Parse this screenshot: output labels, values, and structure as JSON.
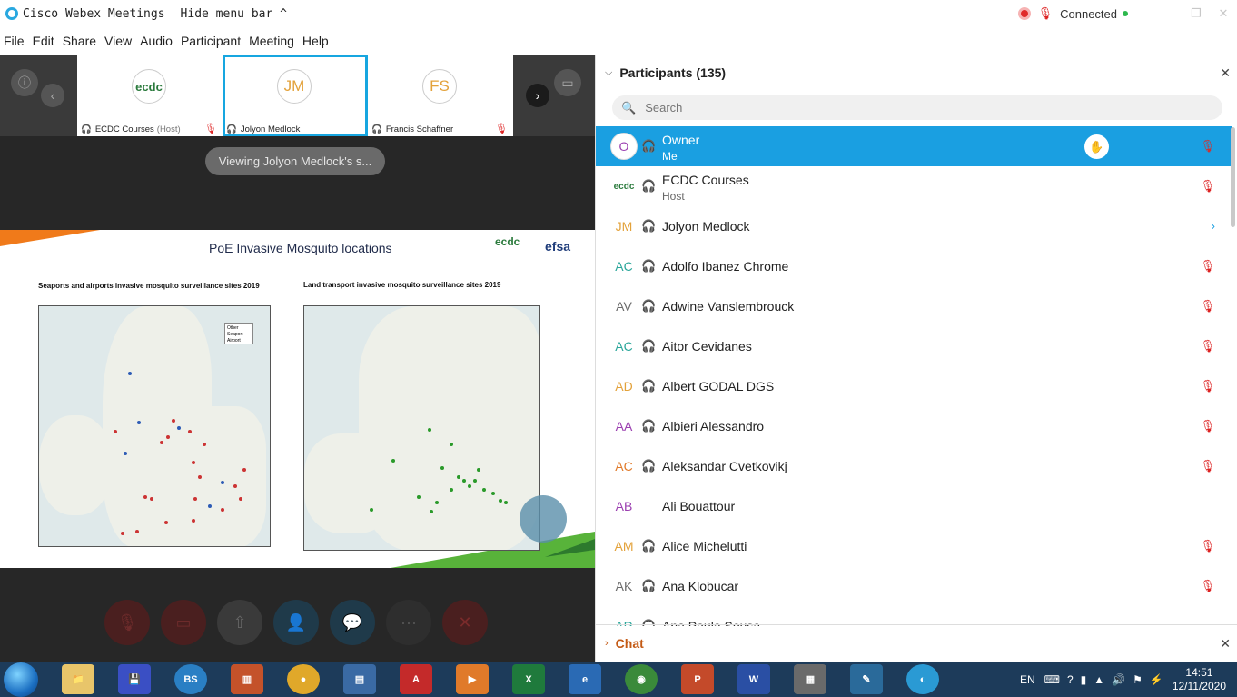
{
  "titlebar": {
    "app_title": "Cisco Webex Meetings",
    "hide_menu": "Hide menu bar ^",
    "connection": "Connected",
    "minimize": "—",
    "maximize": "❐",
    "close": "✕"
  },
  "menu": [
    "File",
    "Edit",
    "Share",
    "View",
    "Audio",
    "Participant",
    "Meeting",
    "Help"
  ],
  "thumbnails": [
    {
      "name": "ECDC Courses",
      "role": "(Host)",
      "initials": "ecdc"
    },
    {
      "name": "Jolyon Medlock",
      "role": "",
      "initials": "JM"
    },
    {
      "name": "Francis Schaffner",
      "role": "",
      "initials": "FS"
    }
  ],
  "viewing_label": "Viewing Jolyon Medlock's s...",
  "slide": {
    "title": "PoE Invasive Mosquito locations",
    "map_left_title": "Seaports and airports invasive mosquito surveillance sites 2019",
    "map_right_title": "Land transport invasive mosquito surveillance sites 2019",
    "legend": [
      "Other",
      "Seaport",
      "Airport"
    ],
    "logo_ecdc": "ecdc",
    "logo_efsa": "efsa"
  },
  "participants": {
    "header": "Participants (135)",
    "search_placeholder": "Search",
    "rows": [
      {
        "initials": "O",
        "name": "Owner",
        "sub": "Me",
        "color": "#9b3fb0"
      },
      {
        "initials": "ecdc",
        "name": "ECDC Courses",
        "sub": "Host",
        "color": "#2a7a3c"
      },
      {
        "initials": "JM",
        "name": "Jolyon Medlock",
        "sub": "",
        "color": "#e3a23b"
      },
      {
        "initials": "AC",
        "name": "Adolfo Ibanez Chrome",
        "sub": "",
        "color": "#2aa69a"
      },
      {
        "initials": "AV",
        "name": "Adwine Vanslembrouck",
        "sub": "",
        "color": "#6b6b6b"
      },
      {
        "initials": "AC",
        "name": "Aitor Cevidanes",
        "sub": "",
        "color": "#2aa69a"
      },
      {
        "initials": "AD",
        "name": "Albert GODAL DGS",
        "sub": "",
        "color": "#e3a23b"
      },
      {
        "initials": "AA",
        "name": "Albieri Alessandro",
        "sub": "",
        "color": "#9b3fb0"
      },
      {
        "initials": "AC",
        "name": "Aleksandar Cvetkovikj",
        "sub": "",
        "color": "#e07a2a"
      },
      {
        "initials": "AB",
        "name": "Ali Bouattour",
        "sub": "",
        "color": "#9b3fb0"
      },
      {
        "initials": "AM",
        "name": "Alice Michelutti",
        "sub": "",
        "color": "#e3a23b"
      },
      {
        "initials": "AK",
        "name": "Ana Klobucar",
        "sub": "",
        "color": "#6b6b6b"
      },
      {
        "initials": "AR",
        "name": "Ana Paula Sousa",
        "sub": "",
        "color": "#2aa69a"
      }
    ]
  },
  "chat": {
    "label": "Chat"
  },
  "taskbar": {
    "lang": "EN",
    "time": "14:51",
    "date": "12/11/2020"
  }
}
